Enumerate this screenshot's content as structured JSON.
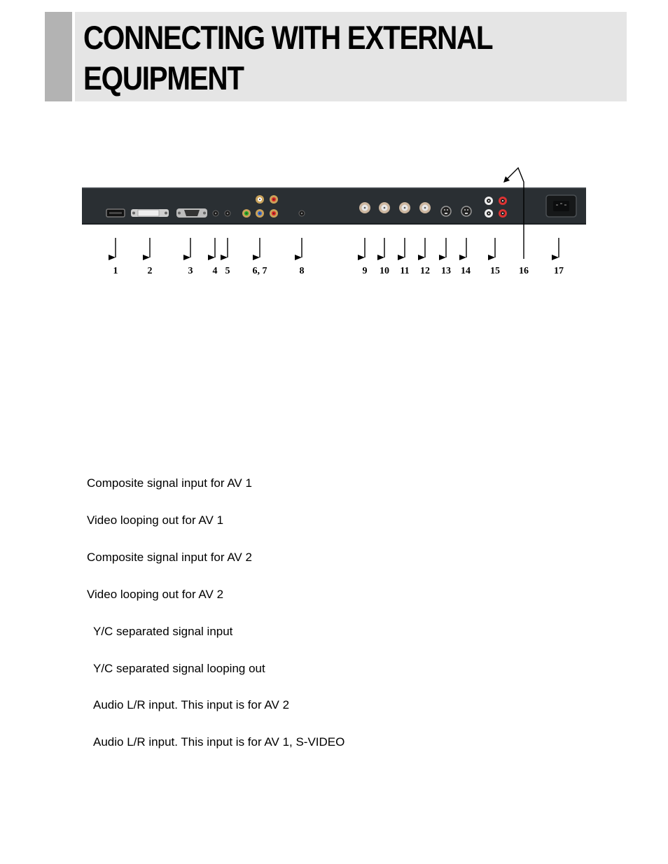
{
  "header": {
    "title_line1": "CONNECTING WITH EXTERNAL",
    "title_line2": "EQUIPMENT"
  },
  "figure": {
    "panel_color": "#2a2f33",
    "connector_labels": [
      "1",
      "2",
      "3",
      "4",
      "5",
      "6, 7",
      "8",
      "9",
      "10",
      "11",
      "12",
      "13",
      "14",
      "15",
      "16",
      "17"
    ],
    "connectors": [
      {
        "label": "1",
        "type": "hdmi-port"
      },
      {
        "label": "2",
        "type": "dvi-port"
      },
      {
        "label": "3",
        "type": "vga-port"
      },
      {
        "label": "4",
        "type": "mini-jack"
      },
      {
        "label": "5",
        "type": "mini-jack"
      },
      {
        "label": "6, 7",
        "type": "rca-component-group"
      },
      {
        "label": "8",
        "type": "mini-jack"
      },
      {
        "label": "9",
        "type": "bnc-port"
      },
      {
        "label": "10",
        "type": "bnc-port"
      },
      {
        "label": "11",
        "type": "bnc-port"
      },
      {
        "label": "12",
        "type": "bnc-port"
      },
      {
        "label": "13",
        "type": "s-video-port"
      },
      {
        "label": "14",
        "type": "s-video-port"
      },
      {
        "label": "15",
        "type": "rca-audio-lr"
      },
      {
        "label": "16",
        "type": "rca-audio-lr"
      },
      {
        "label": "17",
        "type": "ac-power-inlet"
      }
    ]
  },
  "descriptions": [
    "Composite signal input for AV 1",
    "Video looping out for AV 1",
    "Composite signal input for AV 2",
    "Video looping out for AV 2",
    "Y/C separated signal input",
    "Y/C separated signal looping out",
    "Audio L/R input. This input is for AV 2",
    "Audio L/R input. This input is for AV 1, S-VIDEO"
  ]
}
